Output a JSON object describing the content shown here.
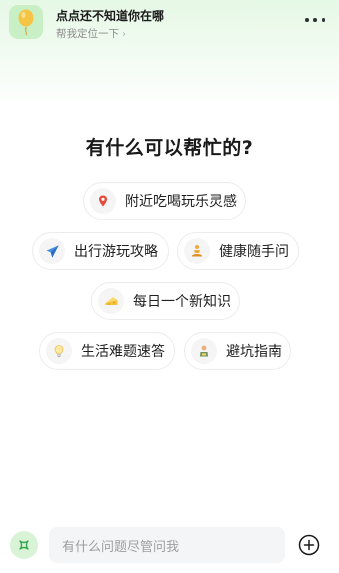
{
  "header": {
    "title": "点点还不知道你在哪",
    "subtitle": "帮我定位一下",
    "subtitle_chevron": "›",
    "logo_icon": "balloon-icon",
    "more_icon": "more-icon"
  },
  "main": {
    "headline": "有什么可以帮忙的?",
    "suggestions": [
      {
        "label": "附近吃喝玩乐灵感",
        "icon": "location-pin-icon"
      },
      {
        "label": "出行游玩攻略",
        "icon": "airplane-icon"
      },
      {
        "label": "健康随手问",
        "icon": "meditation-icon"
      },
      {
        "label": "每日一个新知识",
        "icon": "cheese-icon"
      },
      {
        "label": "生活难题速答",
        "icon": "lightbulb-icon"
      },
      {
        "label": "避坑指南",
        "icon": "guide-icon"
      }
    ]
  },
  "input_bar": {
    "placeholder": "有什么问题尽管问我",
    "avatar_icon": "assistant-icon",
    "add_icon": "plus-circle-icon"
  },
  "colors": {
    "header_gradient": "#e6f8e6",
    "brand_green": "#c8f0c4",
    "chip_border": "#ececec",
    "input_background": "#f4f5f6"
  }
}
